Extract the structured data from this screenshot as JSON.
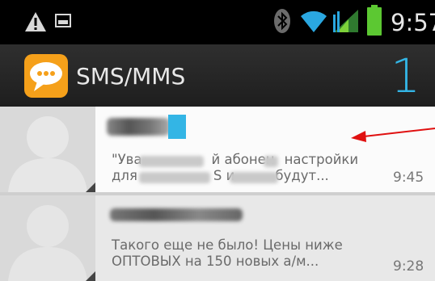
{
  "status_bar": {
    "time": "9:57",
    "icons": [
      "warning-icon",
      "image-icon",
      "bluetooth-icon",
      "wifi-icon",
      "signal-icon",
      "battery-icon"
    ]
  },
  "action_bar": {
    "title": "SMS/MMS",
    "unread_count": "1",
    "icon": "sms-bubble-icon",
    "icon_color": "#f5a01a",
    "accent_color": "#33b5e5"
  },
  "messages": [
    {
      "preview_line1": "\"Ува",
      "preview_line1_b": "й абонен",
      "preview_line1_c": "настройки",
      "preview_line2": "для",
      "preview_line2_b": "S и",
      "preview_line2_c": "будут...",
      "time": "9:45",
      "unread": true
    },
    {
      "preview_line1": "Такого еще не было! Цены ниже",
      "preview_line2": "ОПТОВЫХ на 150 новых а/м...",
      "time": "9:28",
      "unread": false
    }
  ],
  "annotation": {
    "color": "#e01010"
  }
}
